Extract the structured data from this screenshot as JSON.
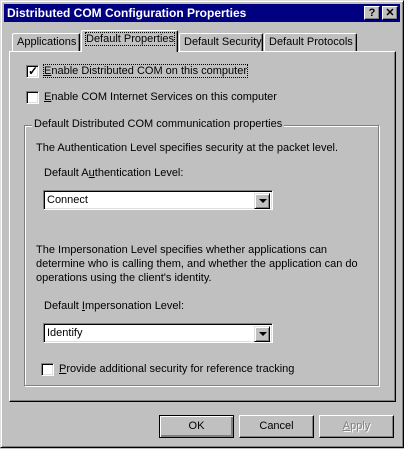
{
  "window": {
    "title": "Distributed COM Configuration Properties",
    "help_label": "?",
    "close_label": "✕"
  },
  "tabs": [
    {
      "label": "Applications",
      "active": false
    },
    {
      "label": "Default Properties",
      "active": true
    },
    {
      "label": "Default Security",
      "active": false
    },
    {
      "label": "Default Protocols",
      "active": false
    }
  ],
  "checkboxes": {
    "enable_dcom": {
      "label_pre": "",
      "label_u": "E",
      "label_post": "nable Distributed COM on this computer",
      "checked": true,
      "mark": "✓"
    },
    "enable_cis": {
      "label_pre": "",
      "label_u": "E",
      "label_post": "nable COM Internet Services on this computer",
      "checked": false
    },
    "ref_tracking": {
      "label_pre": "",
      "label_u": "P",
      "label_post": "rovide additional security for reference tracking",
      "checked": false
    }
  },
  "group": {
    "title": "Default Distributed COM communication properties",
    "auth_desc": "The Authentication Level specifies security at the packet level.",
    "auth_label_pre": "Default A",
    "auth_label_u": "u",
    "auth_label_post": "thentication Level:",
    "auth_value": "Connect",
    "imp_desc_1": "The Impersonation Level specifies whether applications can",
    "imp_desc_2": "determine who is calling them, and whether the application can do",
    "imp_desc_3": "operations using the client's identity.",
    "imp_label_pre": "Default ",
    "imp_label_u": "I",
    "imp_label_post": "mpersonation Level:",
    "imp_value": "Identify"
  },
  "buttons": {
    "ok": "OK",
    "cancel": "Cancel",
    "apply_pre": "",
    "apply_u": "A",
    "apply_post": "pply"
  }
}
